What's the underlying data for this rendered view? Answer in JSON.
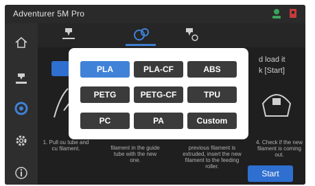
{
  "app": {
    "title": "Adventurer 5M Pro"
  },
  "status_icons": [
    {
      "name": "network-icon",
      "color": "#3aa35a"
    },
    {
      "name": "printer-status-icon",
      "color": "#c73a3a"
    }
  ],
  "sidebar": {
    "items": [
      {
        "name": "home-icon"
      },
      {
        "name": "print-nozzle-icon"
      },
      {
        "name": "filament-icon",
        "active": true
      },
      {
        "name": "settings-gear-icon"
      },
      {
        "name": "info-icon"
      }
    ]
  },
  "tabs": [
    {
      "name": "nozzle-tab"
    },
    {
      "name": "filament-spool-tab",
      "active": true
    },
    {
      "name": "nozzle-settings-tab"
    }
  ],
  "background_steps": {
    "hint_line1": "d load it",
    "hint_line2": "k [Start]",
    "step1": "1. Pull ou tube and cu filament.",
    "step2": "filament in the guide tube with the new one.",
    "step3": "previous filament is extruded, insert the new filament to the feeding roller.",
    "step4": "4. Check if the new filament is coming out.",
    "start_label": "Start"
  },
  "material_menu": {
    "selected": "PLA",
    "options": [
      "PLA",
      "PLA-CF",
      "ABS",
      "PETG",
      "PETG-CF",
      "TPU",
      "PC",
      "PA",
      "Custom"
    ]
  },
  "colors": {
    "accent": "#3f82d8",
    "button": "#3b3b3b",
    "panel": "#ffffff",
    "background": "#262626"
  }
}
